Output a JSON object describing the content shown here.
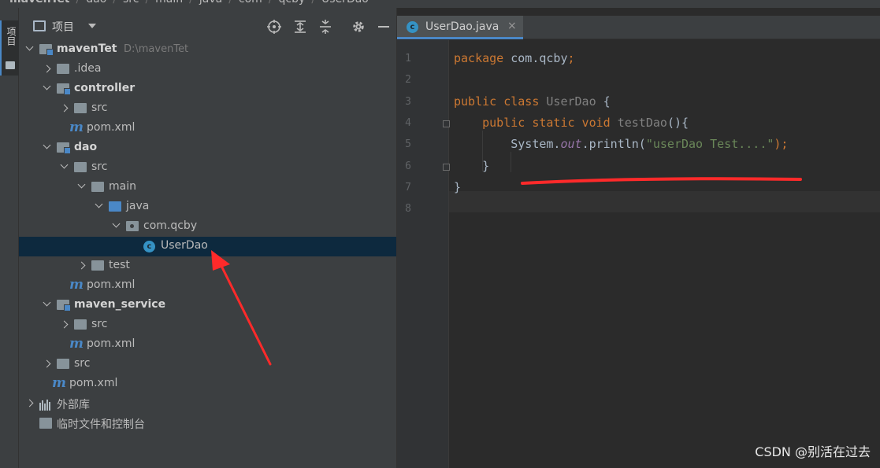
{
  "breadcrumb": [
    "mavenTet",
    "dao",
    "src",
    "main",
    "java",
    "com",
    "qcby",
    "UserDao"
  ],
  "left_stripe": {
    "project_tab_label": "项目"
  },
  "project_panel": {
    "title": "项目",
    "icons": [
      "crosshair-icon",
      "expand-all-icon",
      "collapse-all-icon",
      "gear-icon",
      "minimize-icon"
    ]
  },
  "tree": [
    {
      "name": "mavenTet",
      "path": "D:\\mavenTet",
      "icon": "module-icon",
      "bold": true,
      "arrow": "down",
      "level": 0
    },
    {
      "name": ".idea",
      "icon": "folder-icon",
      "arrow": "right",
      "level": 1
    },
    {
      "name": "controller",
      "icon": "module-icon",
      "bold": true,
      "arrow": "down",
      "level": 1
    },
    {
      "name": "src",
      "icon": "folder-icon",
      "arrow": "right",
      "level": 2
    },
    {
      "name": "pom.xml",
      "icon": "maven-icon",
      "level": 2
    },
    {
      "name": "dao",
      "icon": "module-icon",
      "bold": true,
      "arrow": "down",
      "level": 1
    },
    {
      "name": "src",
      "icon": "folder-icon",
      "arrow": "down",
      "level": 2
    },
    {
      "name": "main",
      "icon": "folder-icon",
      "arrow": "down",
      "level": 3
    },
    {
      "name": "java",
      "icon": "source-folder-icon",
      "arrow": "down",
      "level": 4
    },
    {
      "name": "com.qcby",
      "icon": "package-icon",
      "arrow": "down",
      "level": 5
    },
    {
      "name": "UserDao",
      "icon": "java-class-icon",
      "level": 6,
      "selected": true
    },
    {
      "name": "test",
      "icon": "folder-icon",
      "arrow": "right",
      "level": 3
    },
    {
      "name": "pom.xml",
      "icon": "maven-icon",
      "level": 2
    },
    {
      "name": "maven_service",
      "icon": "module-icon",
      "bold": true,
      "arrow": "down",
      "level": 1
    },
    {
      "name": "src",
      "icon": "folder-icon",
      "arrow": "right",
      "level": 2
    },
    {
      "name": "pom.xml",
      "icon": "maven-icon",
      "level": 2
    },
    {
      "name": "src",
      "icon": "folder-icon",
      "arrow": "right",
      "level": 1
    },
    {
      "name": "pom.xml",
      "icon": "maven-icon",
      "level": 1
    },
    {
      "name": "外部库",
      "icon": "library-icon",
      "arrow": "right",
      "level": 0
    },
    {
      "name": "临时文件和控制台",
      "icon": "scratch-icon",
      "level": 0
    }
  ],
  "editor": {
    "tab": {
      "label": "UserDao.java",
      "close": "×"
    },
    "line_numbers": [
      "1",
      "2",
      "3",
      "4",
      "5",
      "6",
      "7",
      "8"
    ],
    "code": [
      [
        {
          "t": "package ",
          "c": "kw"
        },
        {
          "t": "com.qcby",
          "c": "cls"
        },
        {
          "t": ";",
          "c": "kw"
        }
      ],
      [],
      [
        {
          "t": "public class ",
          "c": "kw"
        },
        {
          "t": "UserDao ",
          "c": "dim"
        },
        {
          "t": "{",
          "c": "cls"
        }
      ],
      [
        {
          "t": "    public static void ",
          "c": "kw"
        },
        {
          "t": "testDao",
          "c": "dim"
        },
        {
          "t": "(){",
          "c": "cls"
        }
      ],
      [
        {
          "t": "        System.",
          "c": "cls"
        },
        {
          "t": "out",
          "c": "fld"
        },
        {
          "t": ".println(",
          "c": "cls"
        },
        {
          "t": "\"userDao Test....\"",
          "c": "str"
        },
        {
          "t": ");",
          "c": "kw"
        }
      ],
      [
        {
          "t": "    }",
          "c": "cls"
        }
      ],
      [
        {
          "t": "}",
          "c": "cls"
        }
      ],
      []
    ]
  },
  "watermark": "CSDN @别活在过去",
  "colors": {
    "accent": "#4a88c7",
    "annotation": "#ff2a2a",
    "selection": "#0d293e"
  }
}
